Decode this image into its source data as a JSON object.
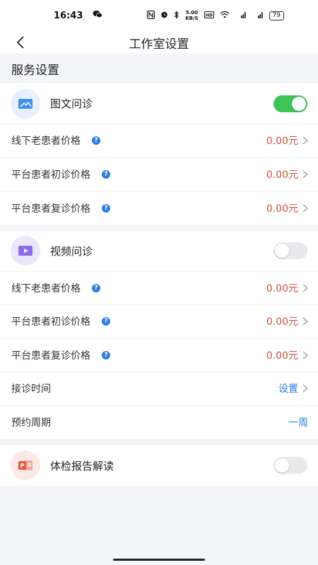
{
  "status": {
    "time": "16:43",
    "speed_value": "5.00",
    "speed_unit": "KB/S",
    "battery": "79"
  },
  "nav": {
    "title": "工作室设置"
  },
  "section": {
    "title": "服务设置"
  },
  "services": [
    {
      "label": "图文问诊",
      "icon": "image-text-icon",
      "enabled": true,
      "items": [
        {
          "label": "线下老患者价格",
          "value": "0.00元"
        },
        {
          "label": "平台患者初诊价格",
          "value": "0.00元"
        },
        {
          "label": "平台患者复诊价格",
          "value": "0.00元"
        }
      ]
    },
    {
      "label": "视频问诊",
      "icon": "video-play-icon",
      "enabled": false,
      "items": [
        {
          "label": "线下老患者价格",
          "value": "0.00元"
        },
        {
          "label": "平台患者初诊价格",
          "value": "0.00元"
        },
        {
          "label": "平台患者复诊价格",
          "value": "0.00元"
        }
      ],
      "extra": [
        {
          "label": "接诊时间",
          "value": "设置"
        },
        {
          "label": "预约周期",
          "value": "一周"
        }
      ]
    },
    {
      "label": "体检报告解读",
      "icon": "report-icon",
      "enabled": false
    }
  ],
  "help_glyph": "?",
  "colors": {
    "toggle_on": "#3fc456",
    "price": "#c8553e",
    "link": "#2f7de1"
  }
}
